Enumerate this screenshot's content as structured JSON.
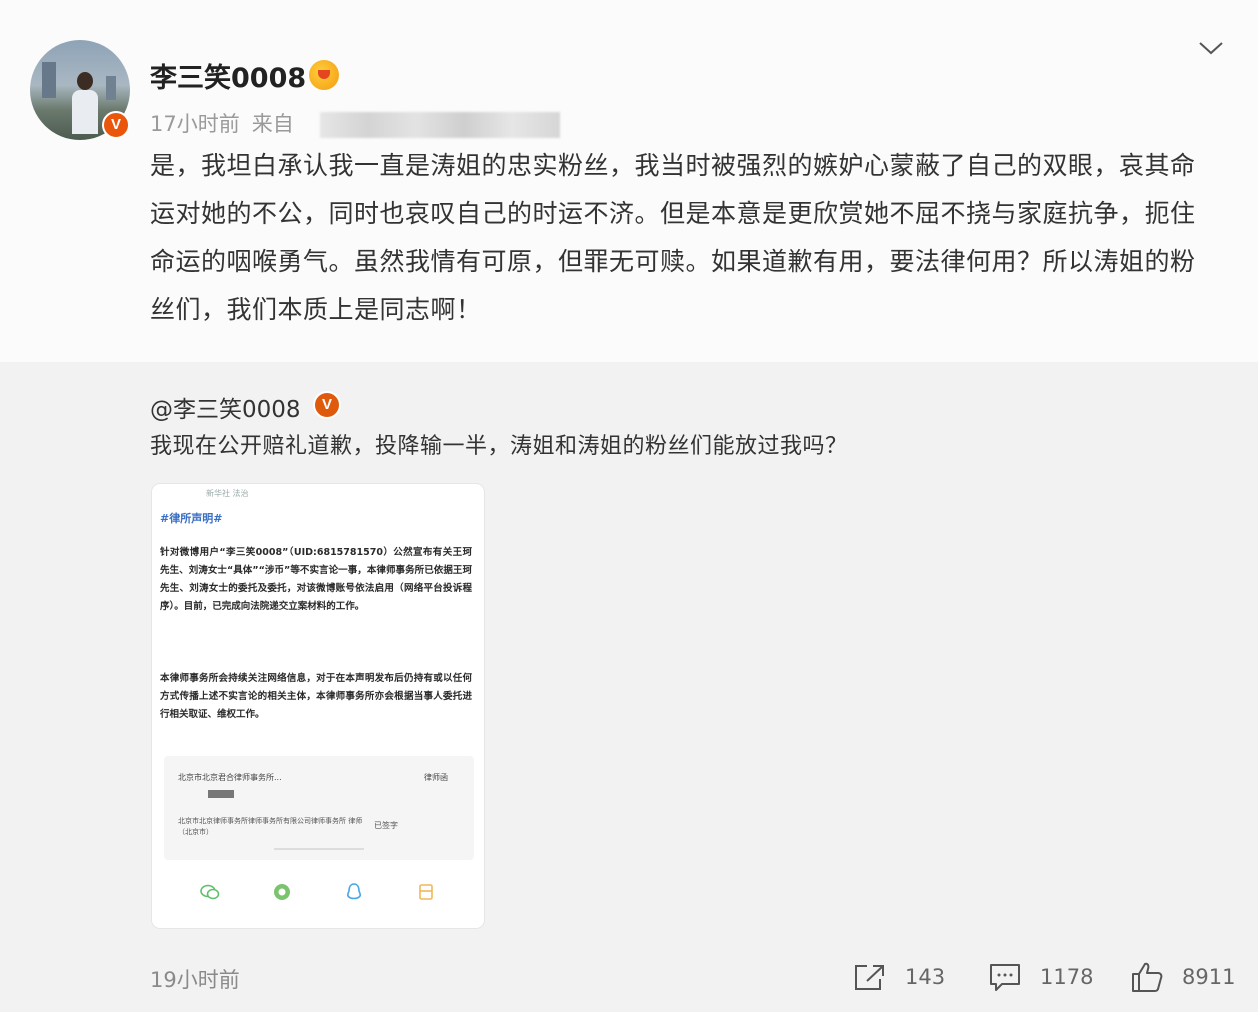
{
  "post": {
    "username": "李三笑0008",
    "verified_badge": "V",
    "meta_time": "17小时前",
    "meta_source_prefix": "来自",
    "body": "是，我坦白承认我一直是涛姐的忠实粉丝，我当时被强烈的嫉妒心蒙蔽了自己的双眼，哀其命运对她的不公，同时也哀叹自己的时运不济。但是本意是更欣赏她不屈不挠与家庭抗争，扼住命运的咽喉勇气。虽然我情有可原，但罪无可赎。如果道歉有用，要法律何用？所以涛姐的粉丝们，我们本质上是同志啊！"
  },
  "repost": {
    "username": "@李三笑0008",
    "verified_badge": "V",
    "text": "我现在公开赔礼道歉，投降输一半，涛姐和涛姐的粉丝们能放过我吗？",
    "image": {
      "top_hint": "新华社 法治",
      "tag": "#律所声明#",
      "para1": "针对微博用户“李三笑0008”（UID:6815781570）公然宣布有关王珂先生、刘涛女士“具体”“涉币”等不实言论一事，本律师事务所已依据王珂先生、刘涛女士的委托及委托，对该微博账号依法启用（网络平台投诉程序）。目前，已完成向法院递交立案材料的工作。",
      "para2": "本律师事务所会持续关注网络信息，对于在本声明发布后仍持有或以任何方式传播上述不实言论的相关主体，本律师事务所亦会根据当事人委托进行相关取证、维权工作。",
      "sign_line1": "北京市北京君合律师事务所...",
      "sign_line1_right": "律师函",
      "sign_line3": "北京市北京律师事务所律师事务所有限公司律师事务所 律师（北京市）",
      "sign_line3_right": "已签字"
    },
    "time": "19小时前"
  },
  "actions": {
    "repost_count": "143",
    "comment_count": "1178",
    "like_count": "8911"
  },
  "icons": {
    "chevron": "chevron-down-icon",
    "repost": "share-out-icon",
    "comment": "comment-icon",
    "like": "thumbs-up-icon"
  },
  "colors": {
    "verified": "#e9560c",
    "text": "#333333",
    "muted": "#8a8a8a",
    "tag": "#3a6fc4"
  }
}
